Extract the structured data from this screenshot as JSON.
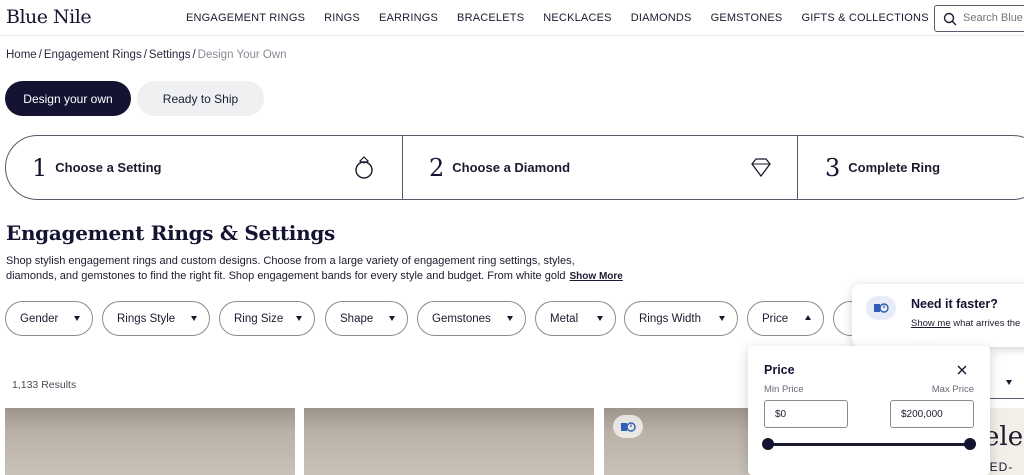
{
  "header": {
    "logo": "Blue Nile",
    "nav": [
      "ENGAGEMENT RINGS",
      "RINGS",
      "EARRINGS",
      "BRACELETS",
      "NECKLACES",
      "DIAMONDS",
      "GEMSTONES",
      "GIFTS & COLLECTIONS"
    ],
    "search_placeholder": "Search Blue N"
  },
  "breadcrumb": {
    "items": [
      "Home",
      "Engagement Rings",
      "Settings"
    ],
    "current": "Design Your Own"
  },
  "toggle": {
    "active": "Design your own",
    "inactive": "Ready to Ship"
  },
  "steps": [
    {
      "num": "1",
      "label": "Choose a Setting",
      "icon": "ring-icon"
    },
    {
      "num": "2",
      "label": "Choose a Diamond",
      "icon": "diamond-icon"
    },
    {
      "num": "3",
      "label": "Complete Ring",
      "icon": ""
    }
  ],
  "main": {
    "title": "Engagement Rings & Settings",
    "desc_line1": "Shop stylish engagement rings and custom designs. Choose from a large variety of engagement ring settings, styles,",
    "desc_line2": "diamonds, and gemstones to find the right fit. Shop engagement bands for every style and budget. From white gold",
    "show_more": "Show More",
    "results": "1,133 Results"
  },
  "filters": [
    "Gender",
    "Rings Style",
    "Ring Size",
    "Shape",
    "Gemstones",
    "Metal",
    "Rings Width",
    "Price"
  ],
  "faster_popover": {
    "title": "Need it faster?",
    "link": "Show me",
    "rest": " what arrives the"
  },
  "price_panel": {
    "title": "Price",
    "min_label": "Min Price",
    "max_label": "Max Price",
    "min_value": "$0",
    "max_value": "$200,000",
    "range_fraction": [
      0,
      1
    ]
  },
  "banner": {
    "big": "eles",
    "small": "LIMITED-"
  },
  "colors": {
    "brand_dark": "#141432",
    "pill_light": "#eef0f2",
    "border": "#8a8a96"
  }
}
